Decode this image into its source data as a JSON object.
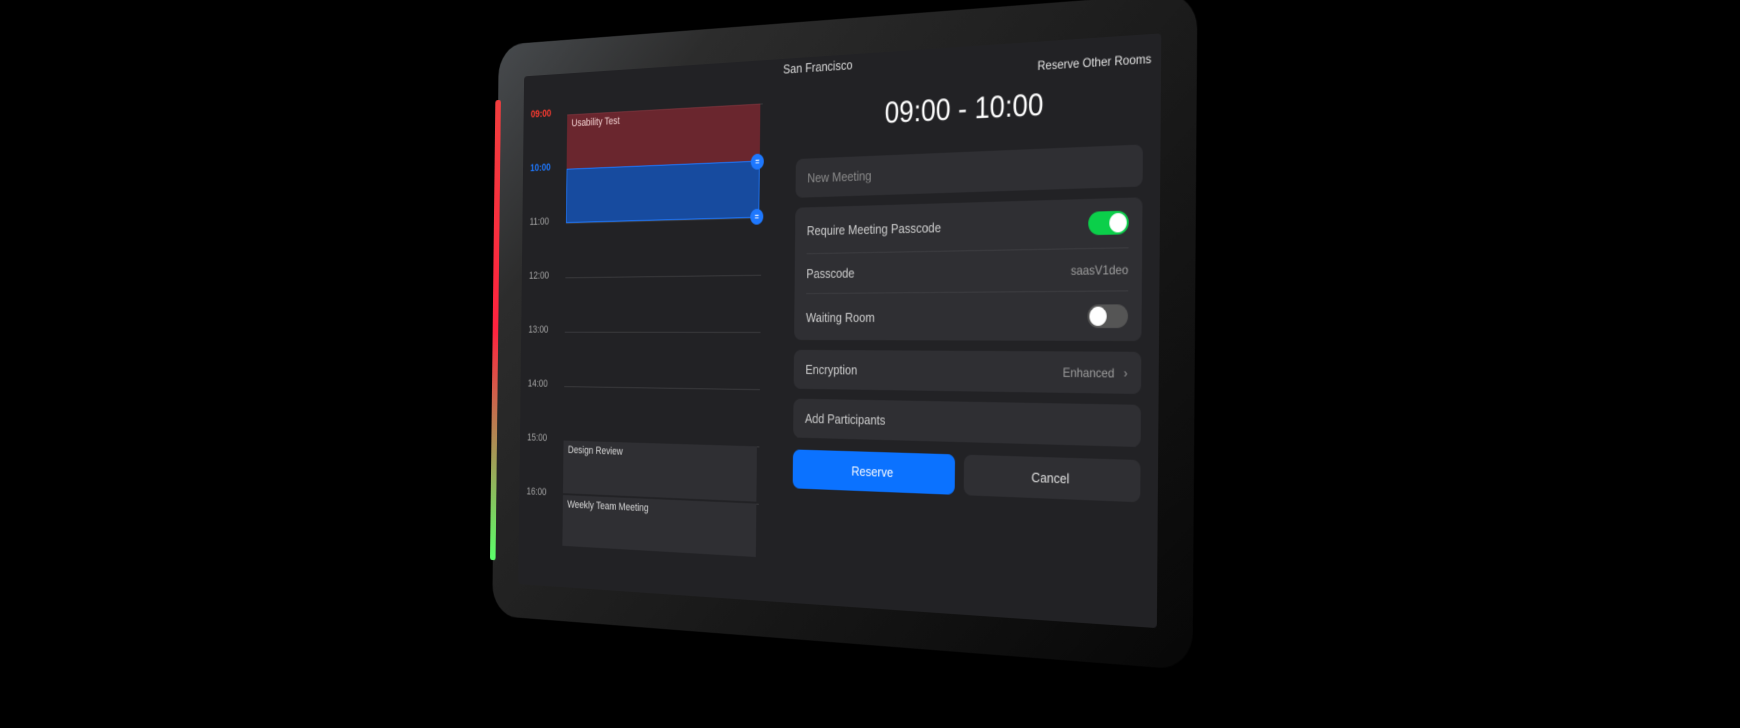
{
  "header": {
    "room_name": "San Francisco",
    "reserve_other_label": "Reserve Other Rooms"
  },
  "timeline": {
    "hours": [
      "09:00",
      "10:00",
      "11:00",
      "12:00",
      "13:00",
      "14:00",
      "15:00",
      "16:00"
    ],
    "highlighted_start_hour": "09:00",
    "highlighted_end_hour": "10:00",
    "events": {
      "usability_test": {
        "title": "Usability Test"
      },
      "design_review": {
        "title": "Design Review"
      },
      "team_meeting": {
        "title": "Weekly Team Meeting"
      }
    }
  },
  "reservation": {
    "time_label": "09:00 - 10:00",
    "topic_placeholder": "New Meeting",
    "passcode_toggle_label": "Require Meeting Passcode",
    "passcode_toggle_on": true,
    "passcode_label": "Passcode",
    "passcode_value": "saasV1deo",
    "waiting_room_label": "Waiting Room",
    "waiting_room_on": false,
    "encryption_label": "Encryption",
    "encryption_value": "Enhanced",
    "add_participants_label": "Add Participants",
    "reserve_button": "Reserve",
    "cancel_button": "Cancel"
  }
}
